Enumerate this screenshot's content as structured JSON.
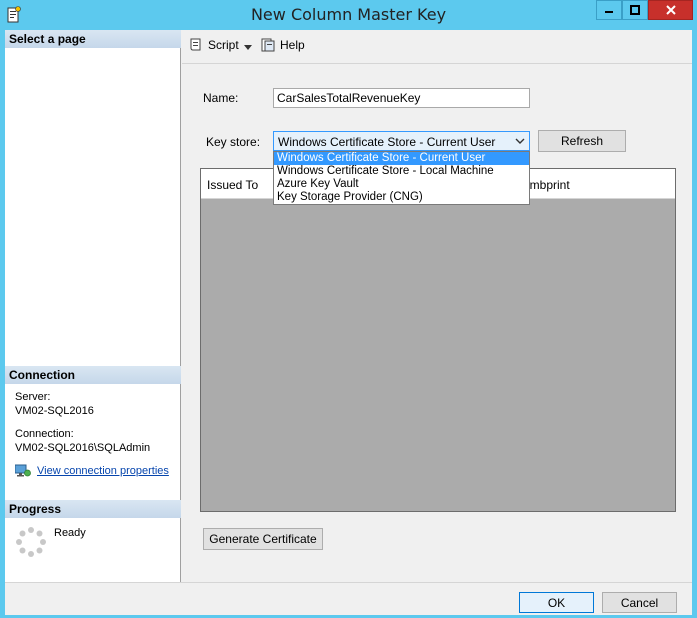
{
  "window": {
    "title": "New Column Master Key"
  },
  "left_pane": {
    "select_page_header": "Select a page",
    "connection_header": "Connection",
    "server_label": "Server:",
    "server_value": "VM02-SQL2016",
    "connection_label": "Connection:",
    "connection_value": "VM02-SQL2016\\SQLAdmin",
    "view_connection_link": "View connection properties",
    "progress_header": "Progress",
    "progress_status": "Ready"
  },
  "toolbar": {
    "script_label": "Script",
    "help_label": "Help"
  },
  "form": {
    "name_label": "Name:",
    "name_value": "CarSalesTotalRevenueKey",
    "key_store_label": "Key store:",
    "key_store_selected": "Windows Certificate Store - Current User",
    "refresh_label": "Refresh",
    "key_store_options": [
      "Windows Certificate Store - Current User",
      "Windows Certificate Store - Local Machine",
      "Azure Key Vault",
      "Key Storage Provider (CNG)"
    ],
    "grid_columns": [
      "Issued To",
      "Thumbprint"
    ],
    "grid_thumbprint_visible": "umbprint",
    "generate_certificate_label": "Generate Certificate"
  },
  "footer": {
    "ok_label": "OK",
    "cancel_label": "Cancel"
  },
  "colors": {
    "title_bar": "#5cc9ee",
    "close_button": "#c7302b",
    "selection": "#3399ff",
    "link": "#0645ad"
  },
  "icons": [
    "app-icon",
    "minimize-icon",
    "maximize-icon",
    "close-icon",
    "script-icon",
    "help-icon",
    "dropdown-chevron-icon",
    "connection-properties-icon",
    "progress-spinner-icon"
  ]
}
